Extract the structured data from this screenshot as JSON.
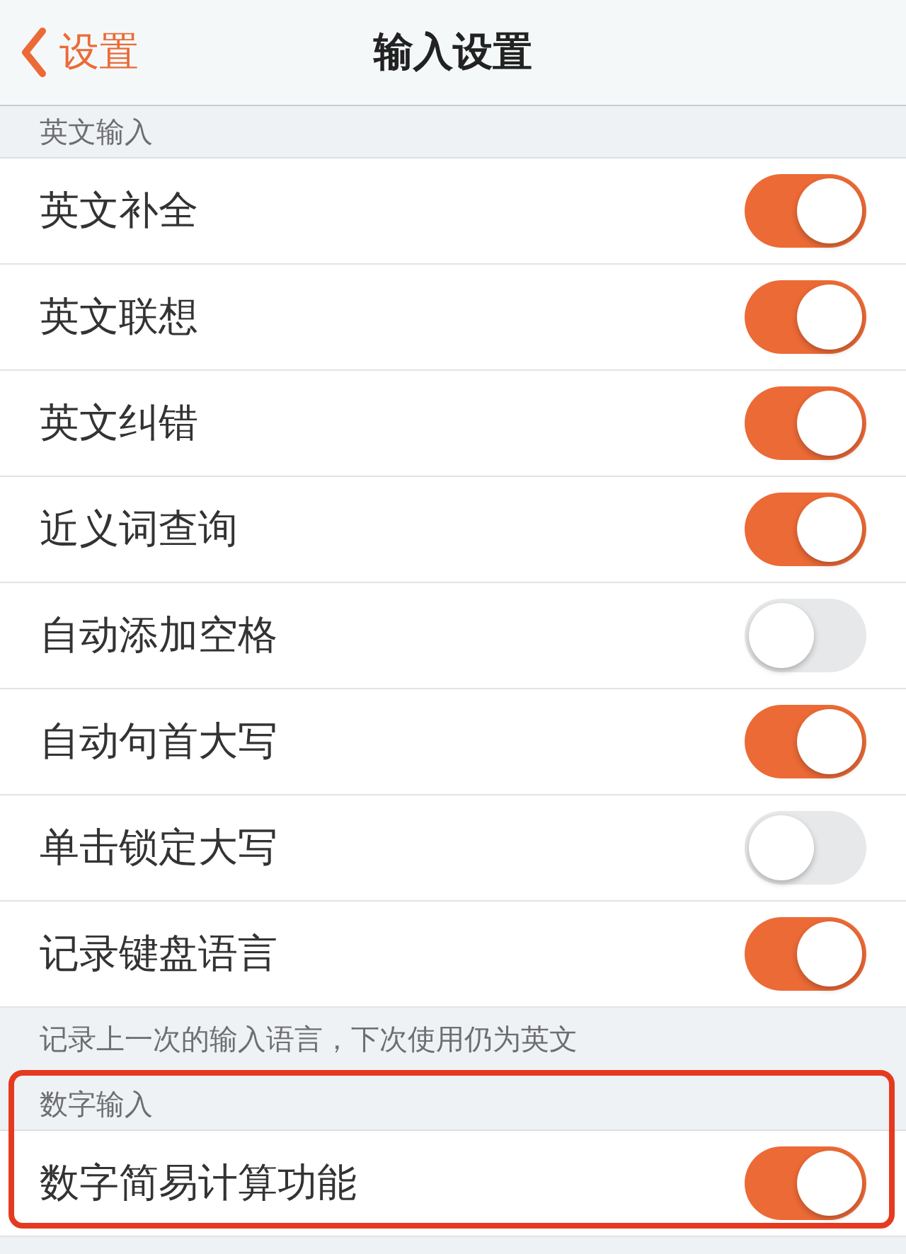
{
  "nav": {
    "back": "设置",
    "title": "输入设置"
  },
  "sections": [
    {
      "header": "英文输入",
      "highlighted": false,
      "rows": [
        {
          "label": "英文补全",
          "on": true
        },
        {
          "label": "英文联想",
          "on": true
        },
        {
          "label": "英文纠错",
          "on": true
        },
        {
          "label": "近义词查询",
          "on": true
        },
        {
          "label": "自动添加空格",
          "on": false
        },
        {
          "label": "自动句首大写",
          "on": true
        },
        {
          "label": "单击锁定大写",
          "on": false
        },
        {
          "label": "记录键盘语言",
          "on": true
        }
      ],
      "footer": "记录上一次的输入语言，下次使用仍为英文"
    },
    {
      "header": "数字输入",
      "highlighted": true,
      "rows": [
        {
          "label": "数字简易计算功能",
          "on": true
        }
      ]
    }
  ]
}
